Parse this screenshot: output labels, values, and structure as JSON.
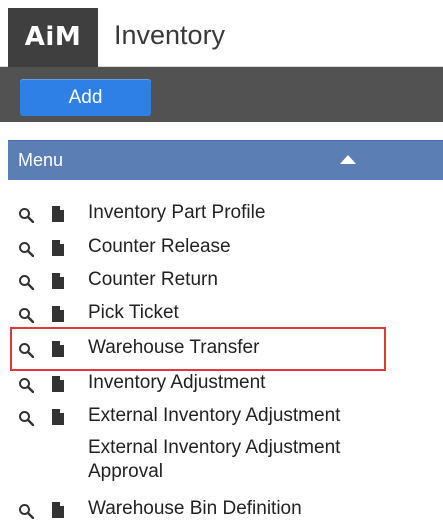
{
  "header": {
    "logo_text": "AiM",
    "title": "Inventory"
  },
  "toolbar": {
    "add_label": "Add"
  },
  "menu": {
    "title": "Menu",
    "collapse_icon": "caret-up-icon",
    "items": [
      {
        "label": "Inventory Part Profile",
        "has_search": true,
        "has_doc": true
      },
      {
        "label": "Counter Release",
        "has_search": true,
        "has_doc": true
      },
      {
        "label": "Counter Return",
        "has_search": true,
        "has_doc": true
      },
      {
        "label": "Pick Ticket",
        "has_search": true,
        "has_doc": true
      },
      {
        "label": "Warehouse Transfer",
        "has_search": true,
        "has_doc": true
      },
      {
        "label": "Inventory Adjustment",
        "has_search": true,
        "has_doc": true
      },
      {
        "label": "External Inventory Adjustment",
        "has_search": true,
        "has_doc": true
      },
      {
        "label": "External Inventory Adjustment Approval",
        "has_search": false,
        "has_doc": false
      },
      {
        "label": "Warehouse Bin Definition",
        "has_search": true,
        "has_doc": true
      }
    ]
  },
  "annotation": {
    "highlight_color": "#e0383b"
  },
  "colors": {
    "menu_header": "#5b7fb4",
    "toolbar": "#525252",
    "add_button": "#2f80e6",
    "logo_bg": "#3f3f3f"
  }
}
